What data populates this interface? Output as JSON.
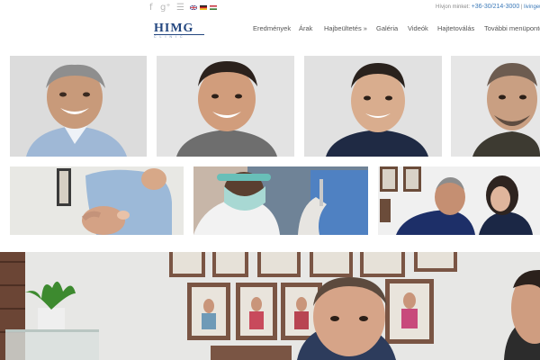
{
  "topbar": {
    "contact_label": "Hívjon minket:",
    "phone": "+36-30/214-3000",
    "separator": "|",
    "link": "livingeur"
  },
  "logo": {
    "main": "HIMG",
    "sub": "CLINIC"
  },
  "nav": {
    "items": [
      "Eredmények",
      "Árak",
      "Hajbeültetés »",
      "Galéria",
      "Videók",
      "Hajtetoválás",
      "További menüpontok"
    ]
  },
  "colors": {
    "brand": "#23467f",
    "link": "#3b79b8",
    "nav_text": "#555555"
  },
  "icons": [
    "facebook-icon",
    "google-plus-icon",
    "rss-icon",
    "flag-uk-icon",
    "flag-de-icon",
    "flag-hu-icon"
  ]
}
